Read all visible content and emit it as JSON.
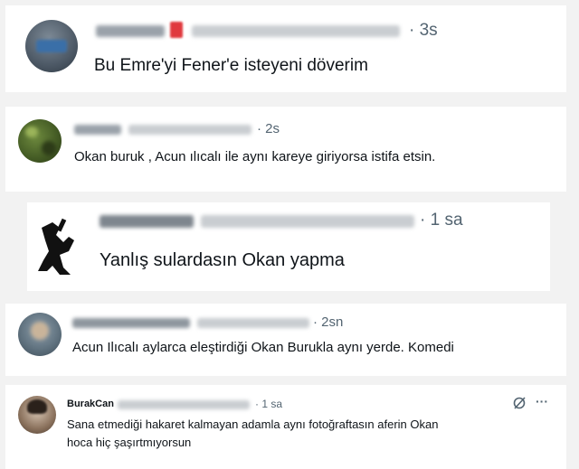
{
  "tweets": [
    {
      "time": "· 3s",
      "text": "Bu Emre'yi Fener'e isteyeni döverim"
    },
    {
      "time": "· 2s",
      "text": "Okan buruk , Acun ılıcalı ile aynı kareye giriyorsa istifa etsin."
    },
    {
      "time": "· 1 sa",
      "text": "Yanlış sulardasın Okan yapma"
    },
    {
      "time": "· 2sn",
      "text": "Acun Ilıcalı aylarca eleştirdiği Okan Burukla aynı yerde. Komedi"
    },
    {
      "name": "BurakCan",
      "time": "· 1 sa",
      "text_line1": "Sana etmediği hakaret kalmayan adamla aynı fotoğraftasın aferin Okan",
      "text_line2": "hoca hiç şaşırtmıyorsun",
      "more": "···"
    }
  ],
  "colors": {
    "background": "#f2f2f2",
    "card": "#ffffff",
    "text": "#0f1419",
    "muted": "#536471",
    "redacted": "#c9cdd1",
    "red_badge": "#e0393e"
  },
  "icons": [
    "grok-icon",
    "more-icon"
  ]
}
